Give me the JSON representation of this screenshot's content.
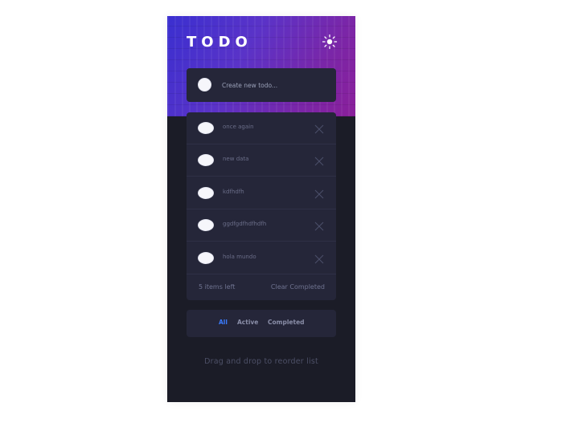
{
  "header": {
    "title": "TODO",
    "theme_icon": "sun-icon"
  },
  "new_todo": {
    "placeholder": "Create new todo..."
  },
  "todos": [
    {
      "text": "once again"
    },
    {
      "text": "new data"
    },
    {
      "text": "kdfhdfh"
    },
    {
      "text": "ggdfgdfhdfhdfh"
    },
    {
      "text": "hola mundo"
    }
  ],
  "footer": {
    "items_left": "5 items left",
    "clear_label": "Clear Completed"
  },
  "filters": {
    "all": "All",
    "active": "Active",
    "completed": "Completed",
    "selected": "All"
  },
  "hint": "Drag and drop to reorder list",
  "colors": {
    "accent": "#3a7bfd",
    "card": "#252639",
    "background": "#1b1c27",
    "gradient_start": "#3a2fd0",
    "gradient_end": "#8a1f9a"
  }
}
